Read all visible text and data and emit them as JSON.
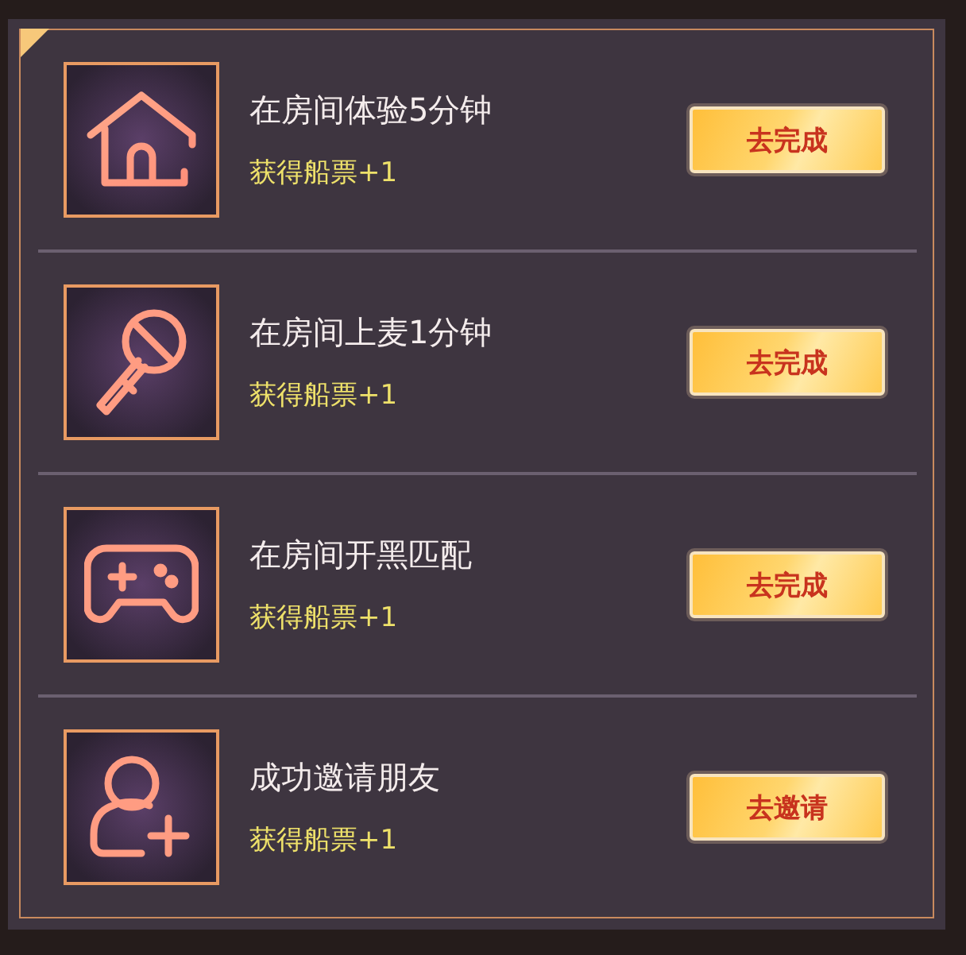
{
  "tasks": [
    {
      "title": "在房间体验5分钟",
      "reward": "获得船票+1",
      "button": "去完成"
    },
    {
      "title": "在房间上麦1分钟",
      "reward": "获得船票+1",
      "button": "去完成"
    },
    {
      "title": "在房间开黑匹配",
      "reward": "获得船票+1",
      "button": "去完成"
    },
    {
      "title": "成功邀请朋友",
      "reward": "获得船票+1",
      "button": "去邀请"
    }
  ]
}
